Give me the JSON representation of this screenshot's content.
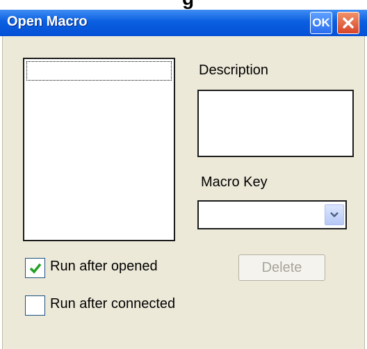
{
  "window": {
    "title": "Open Macro",
    "ok_label": "OK",
    "clipped_top_text": "g"
  },
  "form": {
    "description_label": "Description",
    "description_value": "",
    "macro_key_label": "Macro Key",
    "macro_key_value": "",
    "run_after_opened": {
      "label": "Run after opened",
      "checked": true
    },
    "run_after_connected": {
      "label": "Run after connected",
      "checked": false
    },
    "delete_label": "Delete",
    "macro_list": []
  },
  "icons": {
    "close": "close-icon",
    "dropdown": "chevron-down-icon",
    "check": "checkmark-icon"
  },
  "colors": {
    "titlebar": "#0550d6",
    "close_button": "#d8442a",
    "dialog_bg": "#ece9d8",
    "checkmark": "#21a121"
  }
}
